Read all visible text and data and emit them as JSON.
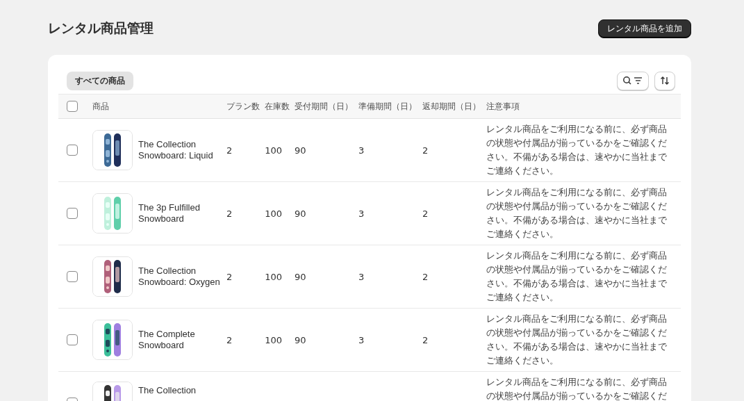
{
  "page": {
    "title": "レンタル商品管理",
    "primary_action": "レンタル商品を追加"
  },
  "tabs": [
    {
      "label": "すべての商品",
      "selected": true
    }
  ],
  "table": {
    "select_all": {
      "checked": false
    },
    "columns": [
      "商品",
      "プラン数",
      "在庫数",
      "受付期間（日）",
      "準備期間（日）",
      "返却期間（日）",
      "注意事項"
    ],
    "rows": [
      {
        "checked": false,
        "name": "The Collection Snowboard: Liquid",
        "plans": "2",
        "stock": "100",
        "acceptance": "90",
        "preparation": "3",
        "return": "2",
        "notes": "レンタル商品をご利用になる前に、必ず商品の状態や付属品が揃っているかをご確認ください。不備がある場合は、速やかに当社までご連絡ください。"
      },
      {
        "checked": false,
        "name": "The 3p Fulfilled Snowboard",
        "plans": "2",
        "stock": "100",
        "acceptance": "90",
        "preparation": "3",
        "return": "2",
        "notes": "レンタル商品をご利用になる前に、必ず商品の状態や付属品が揃っているかをご確認ください。不備がある場合は、速やかに当社までご連絡ください。"
      },
      {
        "checked": false,
        "name": "The Collection Snowboard: Oxygen",
        "plans": "2",
        "stock": "100",
        "acceptance": "90",
        "preparation": "3",
        "return": "2",
        "notes": "レンタル商品をご利用になる前に、必ず商品の状態や付属品が揃っているかをご確認ください。不備がある場合は、速やかに当社までご連絡ください。"
      },
      {
        "checked": false,
        "name": "The Complete Snowboard",
        "plans": "2",
        "stock": "100",
        "acceptance": "90",
        "preparation": "3",
        "return": "2",
        "notes": "レンタル商品をご利用になる前に、必ず商品の状態や付属品が揃っているかをご確認ください。不備がある場合は、速やかに当社までご連絡ください。"
      },
      {
        "checked": false,
        "name": "The Collection",
        "notes": "レンタル商品をご利用になる前に、必ず商品の状態や付属品が揃っているかをご確認くだ"
      }
    ]
  }
}
